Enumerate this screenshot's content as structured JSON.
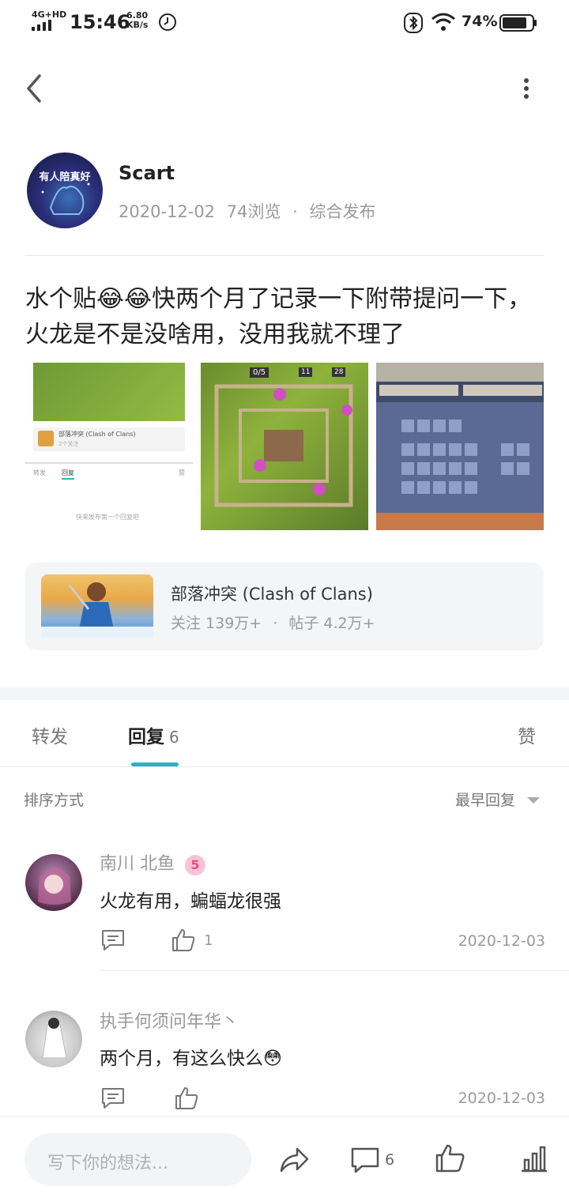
{
  "status_bar": {
    "network": "4G+HD",
    "time": "15:46",
    "speed_value": "6.80",
    "speed_unit": "KB/s",
    "battery": "74%"
  },
  "post": {
    "author_name": "Scart",
    "avatar_caption": "有人陪真好",
    "date": "2020-12-02",
    "views": "74浏览",
    "source": "综合发布",
    "text": "水个贴😂😂快两个月了记录一下附带提问一下，火龙是不是没啥用，没用我就不理了",
    "image1_card_title": "部落冲突 (Clash of Clans)",
    "image1_card_sub": "2个关注",
    "image1_tabs": [
      "转发",
      "回复",
      "赞"
    ],
    "image1_empty": "快来发布第一个回复吧",
    "image2_resources": [
      "0/5",
      "11",
      "28"
    ]
  },
  "game_card": {
    "title": "部落冲突 (Clash of Clans)",
    "followers": "关注 139万+",
    "posts": "帖子 4.2万+"
  },
  "tabs": {
    "forward": "转发",
    "reply": "回复",
    "reply_count": "6",
    "like": "赞"
  },
  "sort": {
    "label": "排序方式",
    "value": "最早回复"
  },
  "comments": [
    {
      "name": "南川 北鱼",
      "level": "5",
      "text": "火龙有用，蝙蝠龙很强",
      "likes": "1",
      "date": "2020-12-03"
    },
    {
      "name": "执手何须问年华丶",
      "text": "两个月，有这么快么😳",
      "likes": "",
      "date": "2020-12-03"
    }
  ],
  "bottom_bar": {
    "placeholder": "写下你的想法...",
    "comment_count": "6"
  },
  "colors": {
    "accent": "#29b3c3",
    "level_badge": "#f06292"
  }
}
